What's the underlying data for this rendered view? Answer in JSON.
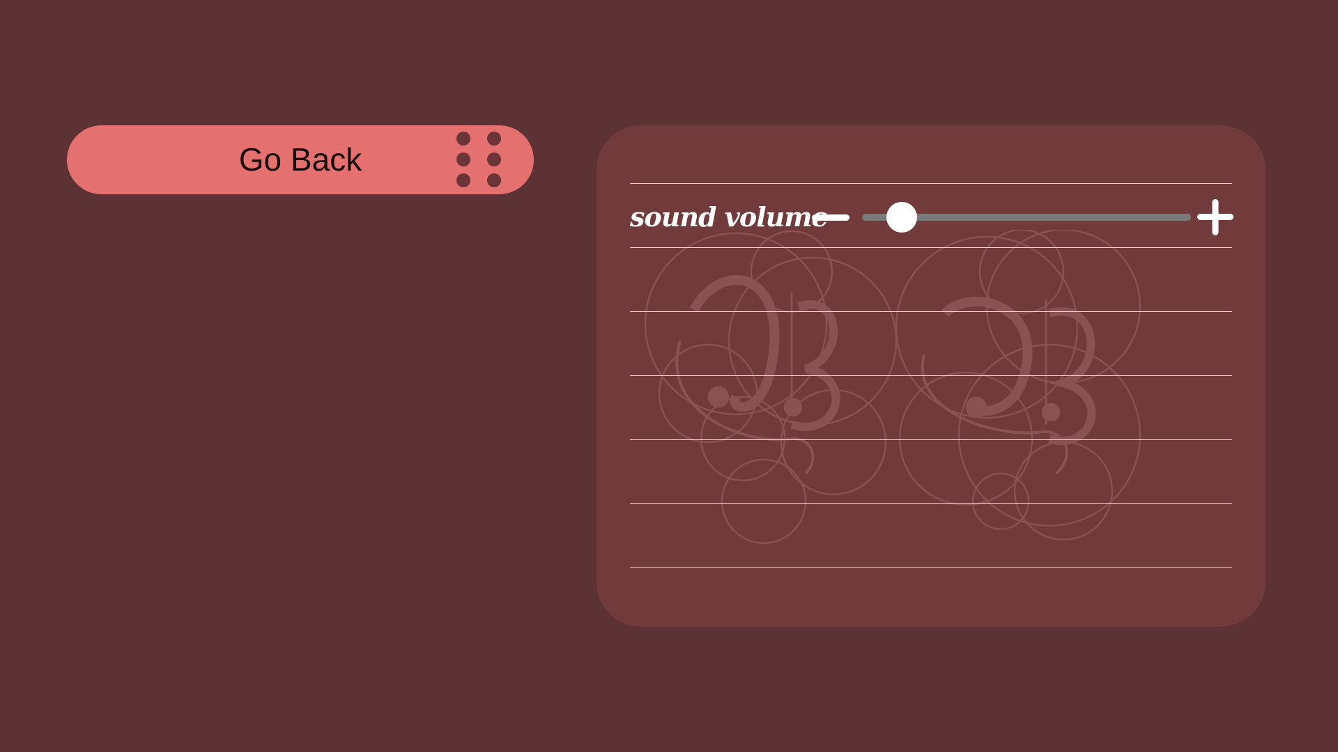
{
  "back_button": {
    "label": "Go Back",
    "icon": "drag-handle-icon"
  },
  "settings": {
    "volume": {
      "label": "sound volume",
      "level": 0.12,
      "decrease_icon": "minus-icon",
      "increase_icon": "plus-icon"
    },
    "watermark_icon": "ornamental-monogram-icon"
  },
  "colors": {
    "background": "#5c3234",
    "panel": "#713b3b",
    "button": "#e57070",
    "dots": "#6b3436",
    "slider_track": "#7a7a7a",
    "text_light": "#ffffff",
    "text_dark": "#1a0a0a"
  }
}
